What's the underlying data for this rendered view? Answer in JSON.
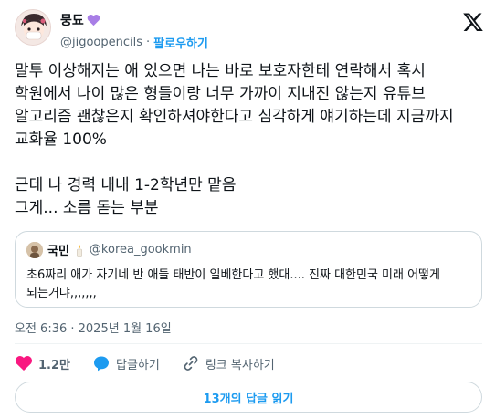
{
  "author": {
    "display_name": "뭉됴",
    "handle": "@jigoopencils",
    "separator": "·",
    "follow_label": "팔로우하기"
  },
  "tweet": {
    "text": "말투 이상해지는 애 있으면 나는 바로 보호자한테 연락해서 혹시 학원에서 나이 많은 형들이랑 너무 가까이 지내진 않는지 유튜브 알고리즘 괜찮은지 확인하셔야한다고 심각하게 얘기하는데 지금까지 교화율 100%\n\n근데 나 경력 내내 1-2학년만 맡음\n그게... 소름 돋는 부분"
  },
  "quoted_tweet": {
    "name": "국민",
    "handle": "@korea_gookmin",
    "text": "초6짜리 애가 자기네 반 애들 태반이 일베한다고 했대.... 진짜 대한민국 미래 어떻게 되는거냐,,,,,,,"
  },
  "timestamp": "오전 6:36 · 2025년 1월 16일",
  "actions": {
    "like_count": "1.2만",
    "reply_label": "답글하기",
    "copy_link_label": "링크 복사하기"
  },
  "read_replies_label": "13개의 답글 읽기",
  "colors": {
    "accent": "#1d9bf0",
    "like": "#f91880",
    "text": "#0f1419",
    "muted": "#536471"
  }
}
